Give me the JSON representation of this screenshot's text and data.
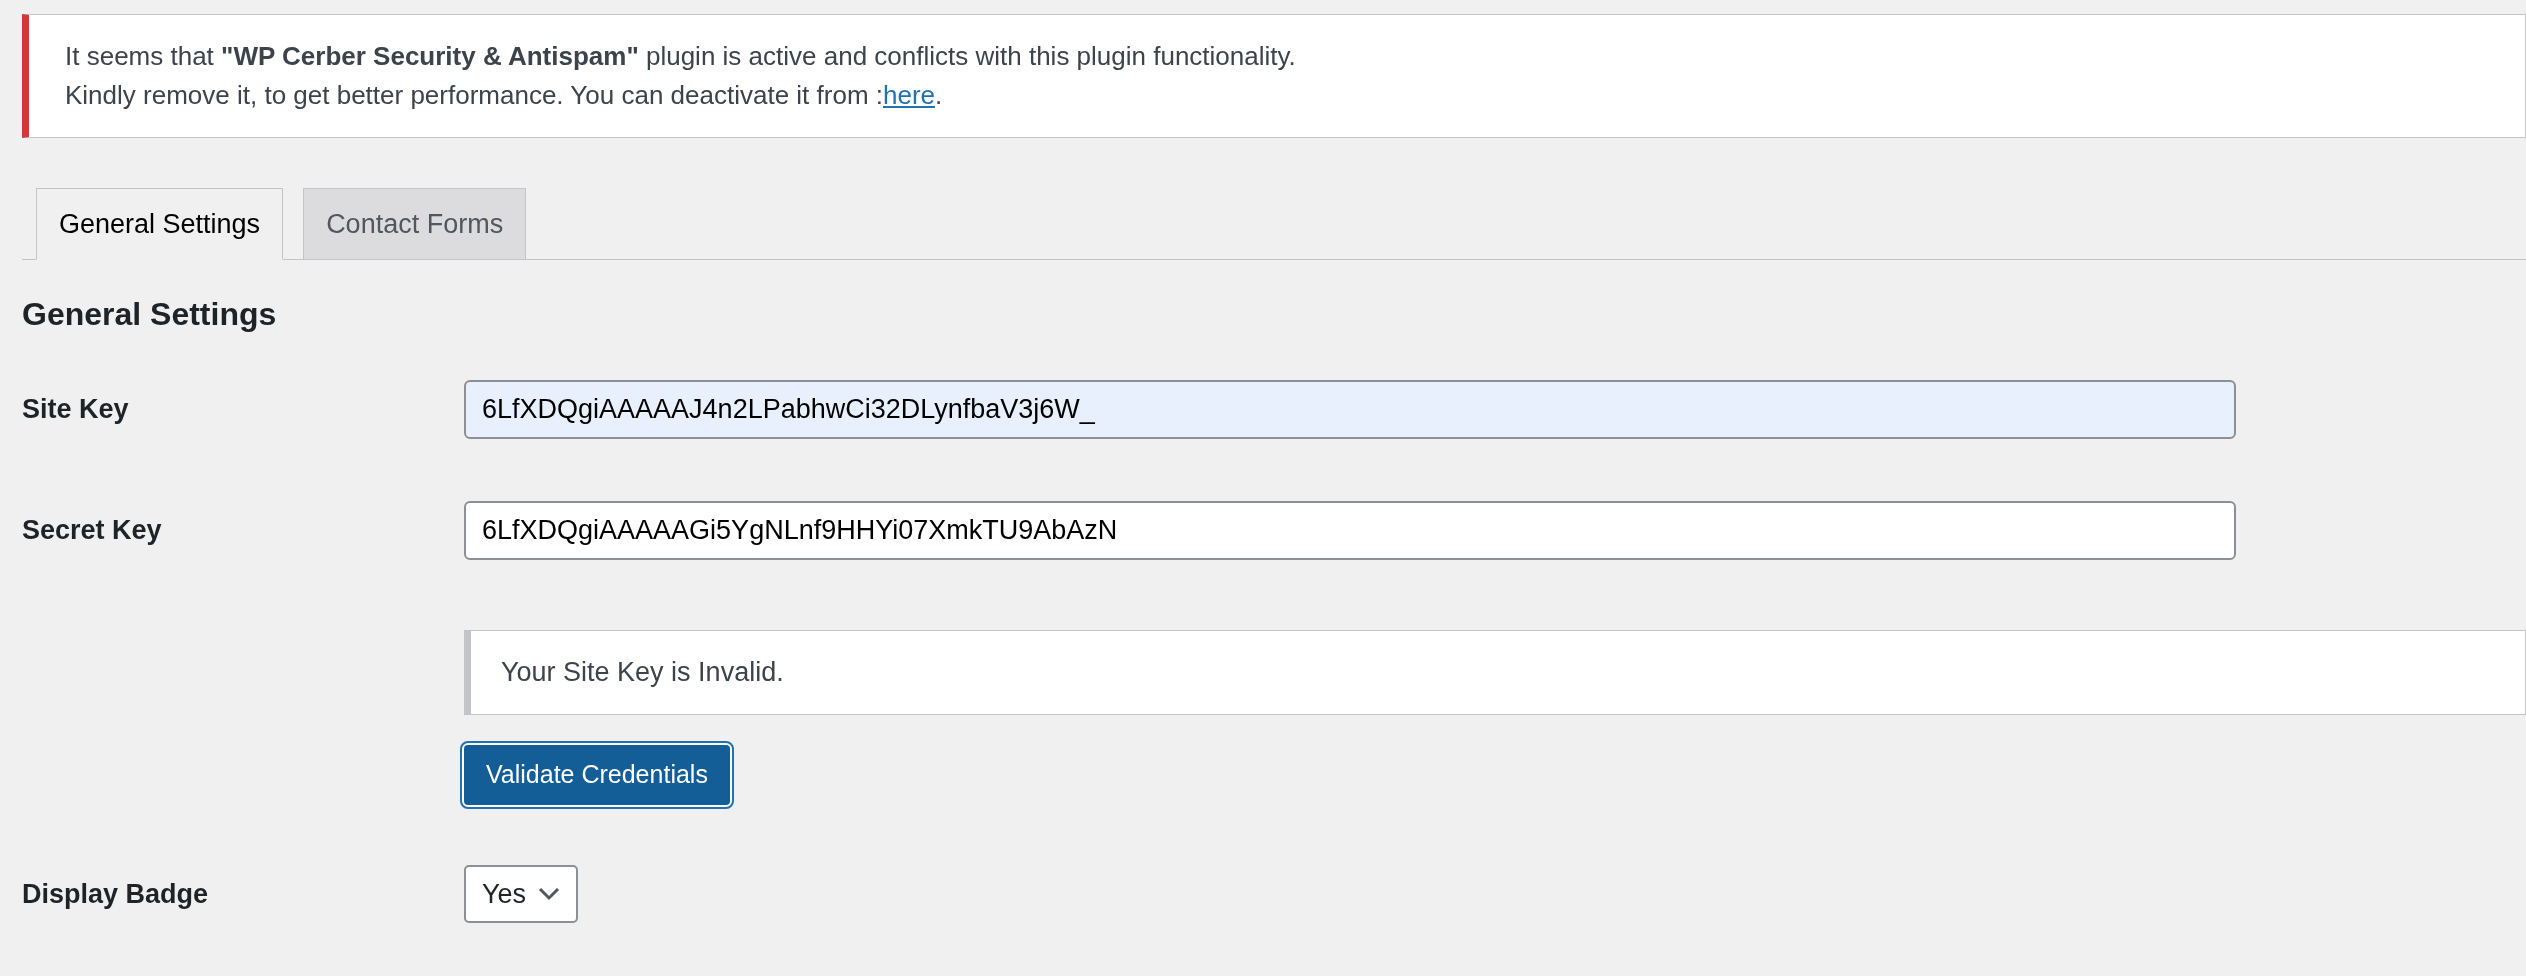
{
  "notice": {
    "error": true,
    "text": "It seems that **\"WP Cerber Security & Antispam\"** plugin is active and conflicts with this plugin functionality.",
    "text_2": "Kindly remove it, to get better performance. You can deactivate it from :",
    "link": "here",
    "link_after": "."
  },
  "tabs": [
    {
      "label": "General Settings",
      "selected": true
    },
    {
      "label": "Contact Forms",
      "selected": false
    }
  ],
  "heading": "General Settings",
  "fields": [
    {
      "label": "Site Key",
      "value": "6LfXDQgiAAAAAJ4n2LPabhwCi32DLynfbaV3j6W_",
      "autofilled": true
    },
    {
      "label": "Secret Key",
      "value": "6LfXDQgiAAAAAGi5YgNLnf9HHYi07XmkTU9AbAzN",
      "autofilled": false
    }
  ],
  "validation_message": "Your Site Key is Invalid.",
  "validate_button": "Validate Credentials",
  "display_badge": {
    "label": "Display Badge",
    "value": "Yes"
  }
}
